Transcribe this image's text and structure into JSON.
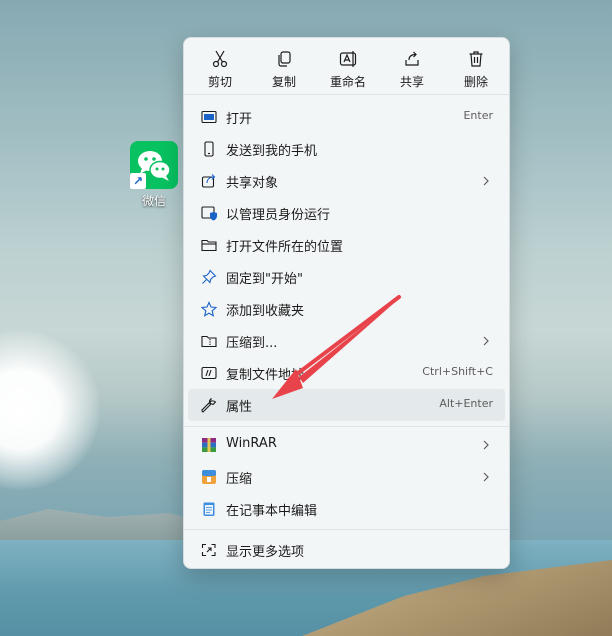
{
  "desktop": {
    "shortcut_label": "微信",
    "shortcut_icon": "wechat-icon",
    "shortcut_overlay_icon": "shortcut-arrow-icon"
  },
  "context_menu": {
    "toolbar": [
      {
        "label": "剪切",
        "icon": "scissors-icon"
      },
      {
        "label": "复制",
        "icon": "copy-icon"
      },
      {
        "label": "重命名",
        "icon": "rename-icon"
      },
      {
        "label": "共享",
        "icon": "share-icon"
      },
      {
        "label": "删除",
        "icon": "trash-icon"
      }
    ],
    "items": [
      {
        "label": "打开",
        "shortcut": "Enter",
        "icon": "open-app-icon"
      },
      {
        "label": "发送到我的手机",
        "icon": "phone-icon"
      },
      {
        "label": "共享对象",
        "icon": "share-with-icon",
        "submenu": true
      },
      {
        "label": "以管理员身份运行",
        "icon": "admin-shield-icon"
      },
      {
        "label": "打开文件所在的位置",
        "icon": "folder-icon"
      },
      {
        "label": "固定到\"开始\"",
        "icon": "pin-icon"
      },
      {
        "label": "添加到收藏夹",
        "icon": "star-icon"
      },
      {
        "label": "压缩到...",
        "icon": "zip-folder-icon",
        "submenu": true
      },
      {
        "label": "复制文件地址",
        "shortcut": "Ctrl+Shift+C",
        "icon": "copy-path-icon"
      },
      {
        "label": "属性",
        "shortcut": "Alt+Enter",
        "icon": "wrench-icon",
        "highlighted": true
      },
      {
        "label": "WinRAR",
        "icon": "winrar-icon",
        "submenu": true
      },
      {
        "label": "压缩",
        "icon": "archive-icon",
        "submenu": true
      },
      {
        "label": "在记事本中编辑",
        "icon": "notepad-icon"
      },
      {
        "label": "显示更多选项",
        "icon": "more-options-icon"
      }
    ]
  },
  "colors": {
    "accent": "#1a64c8",
    "wechat_green": "#08c160",
    "annotation_arrow": "#e8434a",
    "menu_bg": "#f3f6f7",
    "hover_bg": "#e4e9ec"
  }
}
